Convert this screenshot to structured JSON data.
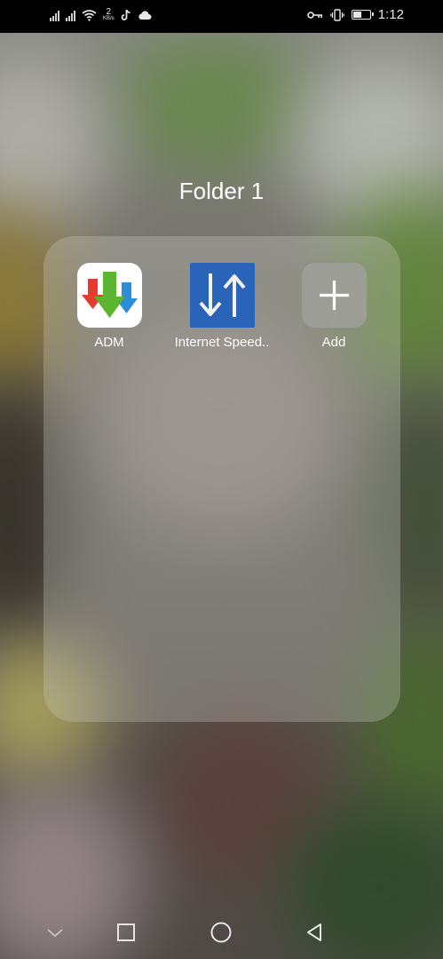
{
  "status_bar": {
    "net_speed_value": "2",
    "net_speed_unit": "KB/s",
    "time": "1:12",
    "battery_level": 0.45
  },
  "folder": {
    "title": "Folder 1",
    "apps": [
      {
        "label": "ADM",
        "icon": "adm-download-arrows-icon"
      },
      {
        "label": "Internet Speed..",
        "icon": "up-down-arrows-icon"
      },
      {
        "label": "Add",
        "icon": "plus-icon"
      }
    ]
  },
  "nav_bar": {
    "buttons": [
      "chevron-down-icon",
      "recents-square-icon",
      "home-circle-icon",
      "back-triangle-icon"
    ]
  },
  "colors": {
    "status_bar_bg": "#000000",
    "panel_bg": "rgba(205,205,200,0.30)",
    "speed_icon_bg": "#2a64b9",
    "adm_red": "#e53b2e",
    "adm_green": "#5cb531",
    "adm_blue": "#2a8fd8"
  }
}
